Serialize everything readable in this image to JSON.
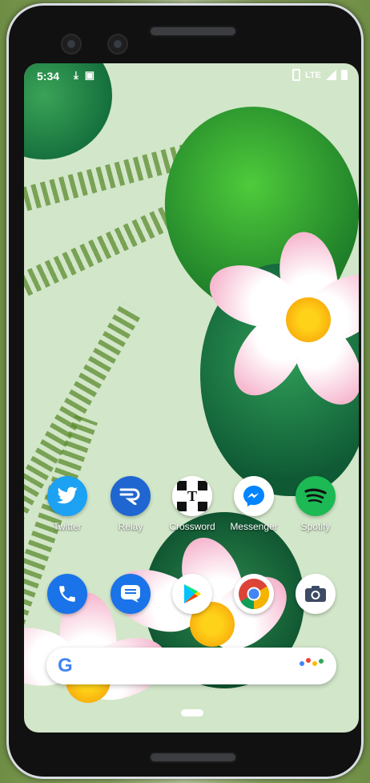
{
  "status_bar": {
    "time": "5:34",
    "network": "LTE",
    "icons_left": [
      "download-icon",
      "image-icon"
    ],
    "icons_right": [
      "vibrate-icon",
      "signal-icon",
      "battery-icon"
    ]
  },
  "home_apps_row1": [
    {
      "label": "Twitter",
      "icon": "twitter-icon",
      "color": "#1DA1F2"
    },
    {
      "label": "Relay",
      "icon": "relay-icon",
      "color": "#1f66d1"
    },
    {
      "label": "Crossword",
      "icon": "crossword-icon",
      "color": "#ffffff"
    },
    {
      "label": "Messenger",
      "icon": "messenger-icon",
      "color": "#ffffff"
    },
    {
      "label": "Spotify",
      "icon": "spotify-icon",
      "color": "#1DB954"
    }
  ],
  "dock_apps": [
    {
      "icon": "phone-icon",
      "color": "#1a73e8"
    },
    {
      "icon": "messages-icon",
      "color": "#1a73e8"
    },
    {
      "icon": "play-store-icon",
      "color": "#ffffff"
    },
    {
      "icon": "chrome-icon",
      "color": "#ffffff"
    },
    {
      "icon": "camera-icon",
      "color": "#ffffff"
    }
  ],
  "search": {
    "logo": "G",
    "assistant_dots": [
      "#4285F4",
      "#EA4335",
      "#FBBC05",
      "#34A853"
    ]
  }
}
